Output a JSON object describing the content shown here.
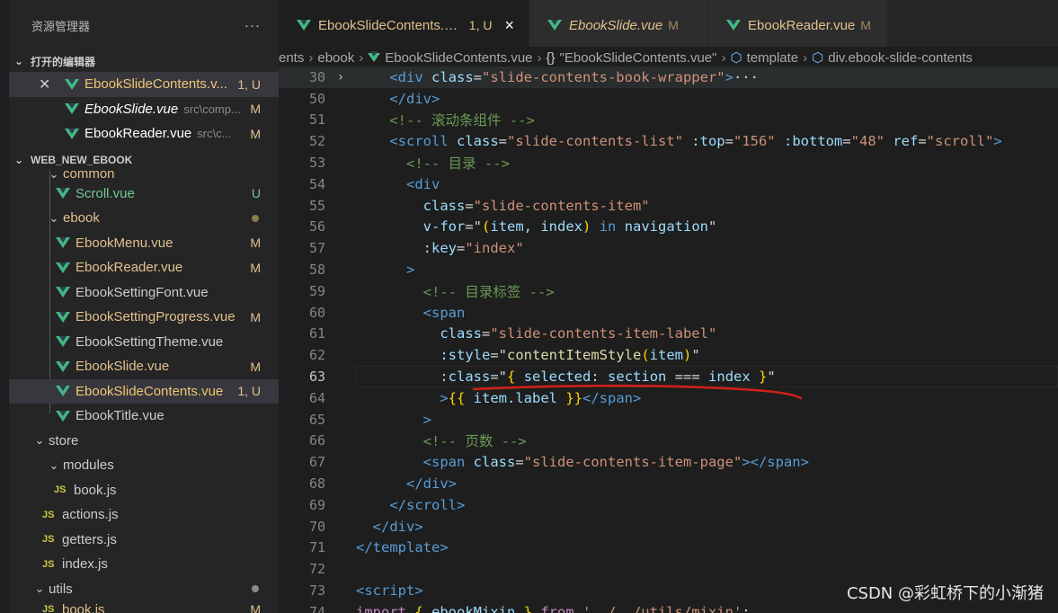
{
  "sidebar": {
    "title": "资源管理器",
    "more": "···",
    "open_editors": {
      "label": "打开的编辑器",
      "items": [
        {
          "name": "EbookSlideContents.v...",
          "path": "",
          "status": "1, U",
          "selected": true,
          "italic": false
        },
        {
          "name": "EbookSlide.vue",
          "path": "src\\comp...",
          "status": "M",
          "selected": false,
          "italic": true
        },
        {
          "name": "EbookReader.vue",
          "path": "src\\c...",
          "status": "M",
          "selected": false,
          "italic": false
        }
      ]
    },
    "project": {
      "label": "WEB_NEW_EBOOK",
      "tree": [
        {
          "kind": "folder",
          "name": "common",
          "depth": 1,
          "partial": true
        },
        {
          "kind": "vue",
          "name": "Scroll.vue",
          "depth": 2,
          "status": "U"
        },
        {
          "kind": "folder",
          "name": "ebook",
          "depth": 1,
          "dot": true
        },
        {
          "kind": "vue",
          "name": "EbookMenu.vue",
          "depth": 2,
          "status": "M"
        },
        {
          "kind": "vue",
          "name": "EbookReader.vue",
          "depth": 2,
          "status": "M"
        },
        {
          "kind": "vue",
          "name": "EbookSettingFont.vue",
          "depth": 2,
          "status": ""
        },
        {
          "kind": "vue",
          "name": "EbookSettingProgress.vue",
          "depth": 2,
          "status": "M"
        },
        {
          "kind": "vue",
          "name": "EbookSettingTheme.vue",
          "depth": 2,
          "status": ""
        },
        {
          "kind": "vue",
          "name": "EbookSlide.vue",
          "depth": 2,
          "status": "M"
        },
        {
          "kind": "vue",
          "name": "EbookSlideContents.vue",
          "depth": 2,
          "status": "1, U",
          "selected": true
        },
        {
          "kind": "vue",
          "name": "EbookTitle.vue",
          "depth": 2,
          "status": ""
        },
        {
          "kind": "folder",
          "name": "store",
          "depth": 0
        },
        {
          "kind": "folder",
          "name": "modules",
          "depth": 1
        },
        {
          "kind": "js",
          "name": "book.js",
          "depth": 2,
          "status": ""
        },
        {
          "kind": "js",
          "name": "actions.js",
          "depth": 1,
          "status": ""
        },
        {
          "kind": "js",
          "name": "getters.js",
          "depth": 1,
          "status": ""
        },
        {
          "kind": "js",
          "name": "index.js",
          "depth": 1,
          "status": ""
        },
        {
          "kind": "folder",
          "name": "utils",
          "depth": 0,
          "dotgrey": true
        },
        {
          "kind": "js",
          "name": "book.js",
          "depth": 1,
          "status": "M",
          "partial": true
        }
      ]
    }
  },
  "tabs": [
    {
      "name": "EbookSlideContents.vue",
      "status": "1, U",
      "active": true,
      "close": "×"
    },
    {
      "name": "EbookSlide.vue",
      "status": "M",
      "active": false,
      "italic": true
    },
    {
      "name": "EbookReader.vue",
      "status": "M",
      "active": false
    }
  ],
  "breadcrumb": [
    "ents",
    "ebook",
    "EbookSlideContents.vue",
    "\"EbookSlideContents.vue\"",
    "template",
    "div.ebook-slide-contents"
  ],
  "editor": {
    "current_line": 63,
    "lines": [
      {
        "n": 30,
        "fold": "›",
        "hl": true
      },
      {
        "n": 50
      },
      {
        "n": 51
      },
      {
        "n": 52
      },
      {
        "n": 53
      },
      {
        "n": 54
      },
      {
        "n": 55
      },
      {
        "n": 56
      },
      {
        "n": 57
      },
      {
        "n": 58
      },
      {
        "n": 59
      },
      {
        "n": 60
      },
      {
        "n": 61
      },
      {
        "n": 62
      },
      {
        "n": 63
      },
      {
        "n": 64
      },
      {
        "n": 65
      },
      {
        "n": 66
      },
      {
        "n": 67
      },
      {
        "n": 68
      },
      {
        "n": 69
      },
      {
        "n": 70
      },
      {
        "n": 71
      },
      {
        "n": 72
      },
      {
        "n": 73
      },
      {
        "n": 74
      }
    ],
    "text": {
      "l30": [
        "    ",
        "<div",
        " class",
        "=",
        "\"slide-contents-book-wrapper\"",
        ">",
        "···"
      ],
      "l50": [
        "    ",
        "</div>"
      ],
      "l51": [
        "    ",
        "<!-- 滚动条组件 -->"
      ],
      "l52": [
        "    ",
        "<scroll",
        " class",
        "=",
        "\"slide-contents-list\"",
        " :top",
        "=",
        "\"156\"",
        " :bottom",
        "=",
        "\"48\"",
        " ref",
        "=",
        "\"scroll\"",
        ">"
      ],
      "l53": [
        "      ",
        "<!-- 目录 -->"
      ],
      "l54": [
        "      ",
        "<div"
      ],
      "l55": [
        "        ",
        "class",
        "=",
        "\"slide-contents-item\""
      ],
      "l56": [
        "        ",
        "v-for",
        "=",
        "\"",
        "(",
        "item, index",
        ")",
        " in ",
        "navigation",
        "\""
      ],
      "l57": [
        "        ",
        ":key",
        "=",
        "\"index\""
      ],
      "l58": [
        "      ",
        ">"
      ],
      "l59": [
        "        ",
        "<!-- 目录标签 -->"
      ],
      "l60": [
        "        ",
        "<span"
      ],
      "l61": [
        "          ",
        "class",
        "=",
        "\"slide-contents-item-label\""
      ],
      "l62": [
        "          ",
        ":style",
        "=",
        "\"",
        "contentItemStyle",
        "(",
        "item",
        ")",
        "\""
      ],
      "l63": [
        "          ",
        ":class",
        "=",
        "\"",
        "{",
        " selected",
        ": ",
        "section",
        " === ",
        "index",
        " }",
        "\""
      ],
      "l64": [
        "          ",
        ">",
        "{{",
        " item.label ",
        "}}",
        "</span>"
      ],
      "l65": [
        "        ",
        ">"
      ],
      "l66": [
        "        ",
        "<!-- 页数 -->"
      ],
      "l67": [
        "        ",
        "<span",
        " class",
        "=",
        "\"slide-contents-item-page\"",
        "></span>"
      ],
      "l68": [
        "      ",
        "</div>"
      ],
      "l69": [
        "    ",
        "</scroll>"
      ],
      "l70": [
        "  ",
        "</div>"
      ],
      "l71": [
        "",
        "</template>"
      ],
      "l72": [
        ""
      ],
      "l73": [
        "",
        "<script>"
      ],
      "l74": [
        "",
        "import",
        " { ",
        "ebookMixin",
        " } ",
        "from",
        " '../../utils/mixin'",
        ";"
      ]
    }
  },
  "annotation_color": "#d0201c",
  "watermark": "CSDN @彩虹桥下的小渐猪"
}
